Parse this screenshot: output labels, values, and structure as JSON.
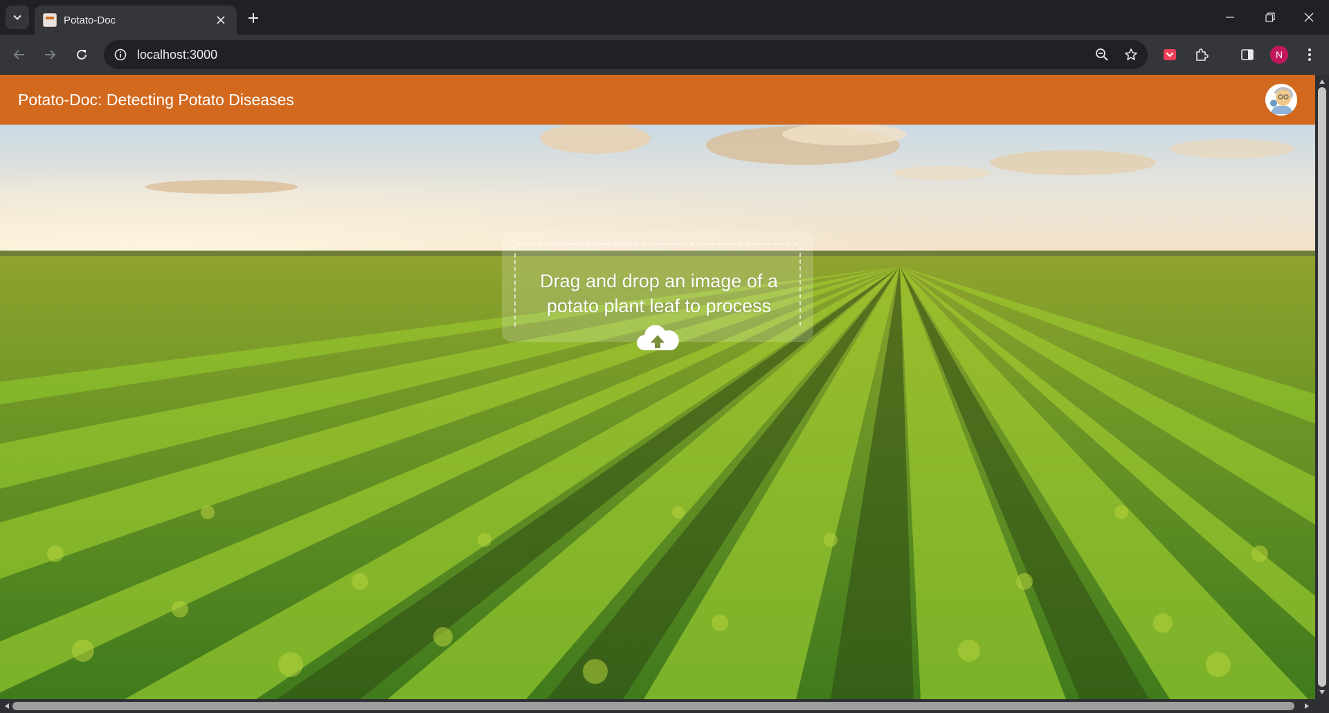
{
  "browser": {
    "tab": {
      "title": "Potato-Doc"
    },
    "url": "localhost:3000",
    "profile_initial": "N"
  },
  "app": {
    "title": "Potato-Doc: Detecting Potato Diseases",
    "upload": {
      "prompt": "Drag and drop an image of a potato plant leaf to process"
    }
  },
  "colors": {
    "header": "#d2691e",
    "chrome_dark": "#202124",
    "chrome_toolbar": "#35363a",
    "profile": "#c2185b"
  },
  "icons": {
    "tab_search": "chevron-down-icon",
    "tab_close": "close-icon",
    "new_tab": "plus-icon",
    "back": "arrow-left-icon",
    "forward": "arrow-right-icon",
    "reload": "reload-icon",
    "site_info": "info-icon",
    "zoom": "zoom-out-icon",
    "bookmark": "star-icon",
    "extension_pocket": "pocket-icon",
    "extensions": "puzzle-icon",
    "side_panel": "side-panel-icon",
    "menu": "more-vertical-icon",
    "upload": "cloud-upload-icon"
  }
}
